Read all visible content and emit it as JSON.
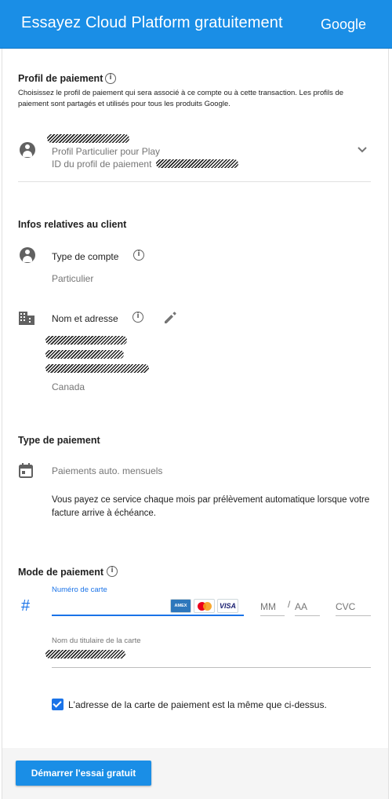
{
  "header": {
    "title": "Essayez Cloud Platform gratuitement",
    "brand": "Google"
  },
  "payment_profile": {
    "title": "Profil de paiement",
    "description": "Choisissez le profil de paiement qui sera associé à ce compte ou à cette transaction. Les profils de paiement sont partagés et utilisés pour tous les produits Google.",
    "profile_type": "Profil Particulier pour Play",
    "profile_id_label": "ID du profil de paiement"
  },
  "customer_info": {
    "title": "Infos relatives au client",
    "account_type_label": "Type de compte",
    "account_type_value": "Particulier",
    "name_address_label": "Nom et adresse",
    "country": "Canada"
  },
  "payment_type": {
    "title": "Type de paiement",
    "value": "Paiements auto. mensuels",
    "description": "Vous payez ce service chaque mois par prélèvement automatique lorsque votre facture arrive à échéance."
  },
  "payment_method": {
    "title": "Mode de paiement",
    "card_number_label": "Numéro de carte",
    "card_number_value": "",
    "hash_symbol": "#",
    "month_placeholder": "MM",
    "slash": "/",
    "year_placeholder": "AA",
    "cvc_placeholder": "CVC",
    "card_brands": [
      "AMEX",
      "MasterCard",
      "VISA"
    ],
    "cardholder_label": "Nom du titulaire de la carte",
    "same_address_label": "L'adresse de la carte de paiement est la même que ci-dessus.",
    "same_address_checked": true
  },
  "footer": {
    "start_button": "Démarrer l'essai gratuit"
  },
  "colors": {
    "primary": "#1a8ee6",
    "checkbox": "#1a73e8"
  }
}
